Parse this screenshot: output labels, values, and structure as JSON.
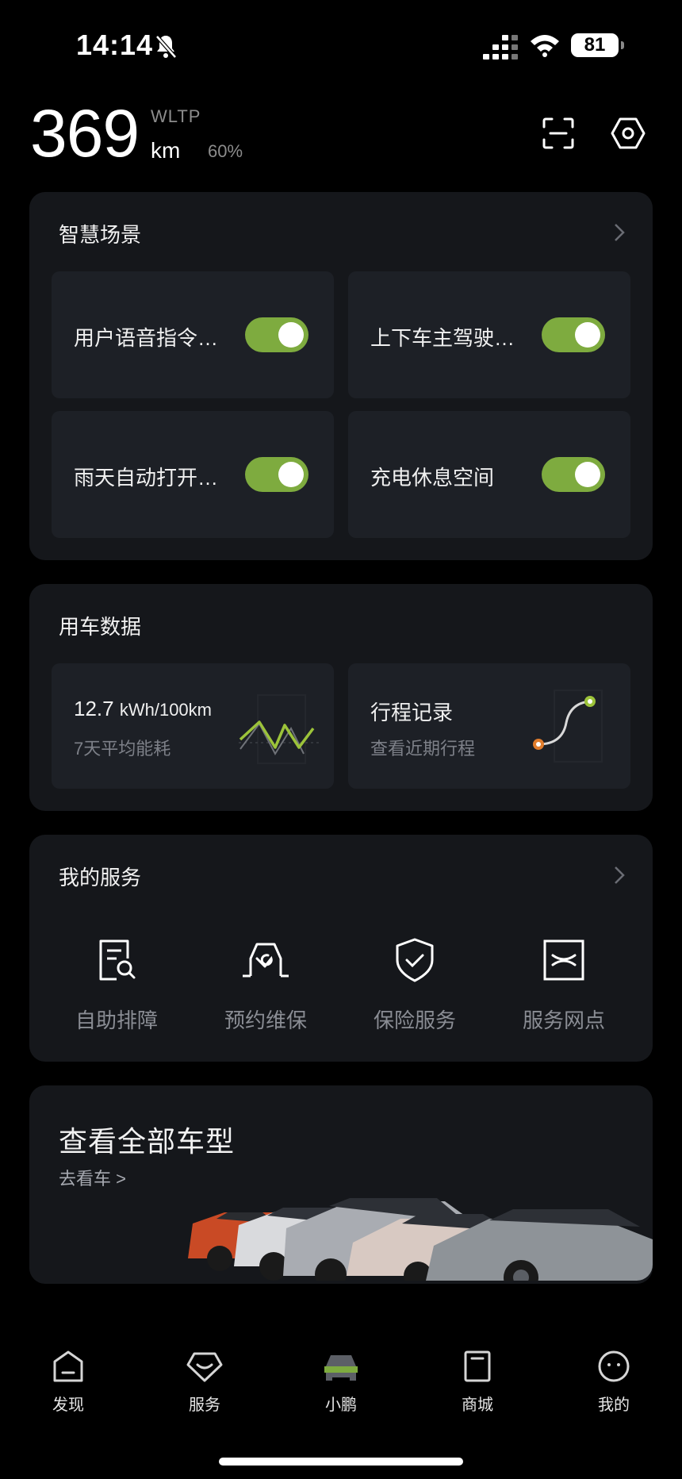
{
  "status_bar": {
    "time": "14:14",
    "battery": "81"
  },
  "header": {
    "range": "369",
    "standard": "WLTP",
    "unit": "km",
    "percent": "60%"
  },
  "smart_scenes": {
    "title": "智慧场景",
    "items": [
      {
        "label": "用户语音指令…",
        "enabled": true
      },
      {
        "label": "上下车主驾驶…",
        "enabled": true
      },
      {
        "label": "雨天自动打开…",
        "enabled": true
      },
      {
        "label": "充电休息空间",
        "enabled": true
      }
    ]
  },
  "vehicle_data": {
    "title": "用车数据",
    "energy": {
      "value": "12.7",
      "unit": "kWh/100km",
      "caption": "7天平均能耗"
    },
    "trips": {
      "title": "行程记录",
      "caption": "查看近期行程"
    }
  },
  "services": {
    "title": "我的服务",
    "items": [
      {
        "label": "自助排障",
        "icon": "diagnosis-icon"
      },
      {
        "label": "预约维保",
        "icon": "maintenance-icon"
      },
      {
        "label": "保险服务",
        "icon": "insurance-icon"
      },
      {
        "label": "服务网点",
        "icon": "service-point-icon"
      }
    ]
  },
  "models": {
    "title": "查看全部车型",
    "link": "去看车 >"
  },
  "tabbar": {
    "items": [
      {
        "label": "发现"
      },
      {
        "label": "服务"
      },
      {
        "label": "小鹏",
        "active": true
      },
      {
        "label": "商城"
      },
      {
        "label": "我的"
      }
    ],
    "active_color": "#7eab3f"
  },
  "colors": {
    "accent": "#7eab3f",
    "card": "#15171b",
    "tile": "#1d2026"
  }
}
